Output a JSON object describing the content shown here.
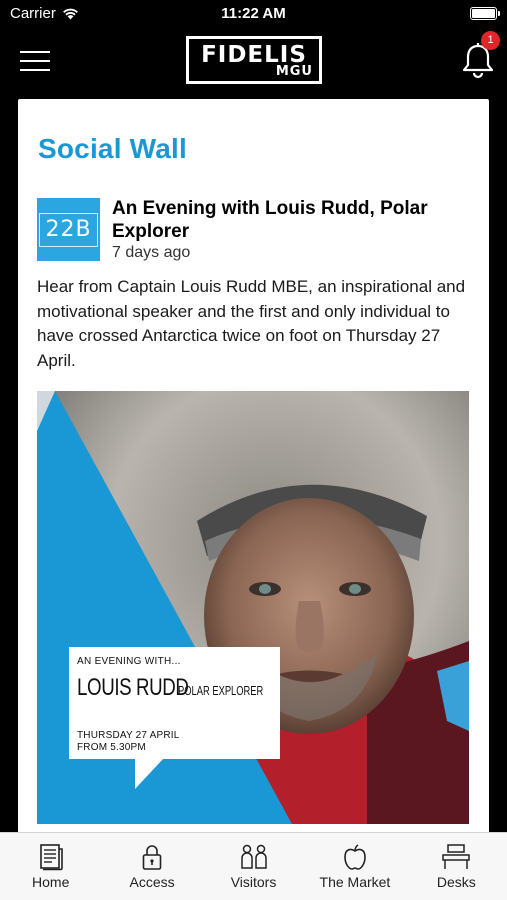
{
  "status_bar": {
    "carrier": "Carrier",
    "time": "11:22 AM"
  },
  "header": {
    "logo_main": "FIDELIS",
    "logo_sub": "MGU",
    "notification_count": "1",
    "icons": {
      "menu": "hamburger-menu-icon",
      "notifications": "bell-icon",
      "signal": "wifi-icon",
      "battery": "battery-icon"
    }
  },
  "page": {
    "title": "Social Wall"
  },
  "post": {
    "avatar_text": "22B",
    "title": "An Evening with Louis Rudd, Polar Explorer",
    "time_ago": "7 days ago",
    "body": "Hear from Captain Louis Rudd MBE, an inspirational and motivational speaker and the first and only individual to have crossed Antarctica twice on foot on Thursday 27 April.",
    "image": {
      "eyebrow": "AN EVENING WITH...",
      "name": "LOUIS RUDD",
      "role": "POLAR EXPLORER",
      "date_line1": "THURSDAY 27 APRIL",
      "date_line2": "FROM 5.30PM",
      "accent_color": "#1a98d5"
    }
  },
  "tabs": [
    {
      "label": "Home",
      "icon": "newspaper-icon"
    },
    {
      "label": "Access",
      "icon": "lock-icon"
    },
    {
      "label": "Visitors",
      "icon": "visitors-icon"
    },
    {
      "label": "The Market",
      "icon": "apple-icon"
    },
    {
      "label": "Desks",
      "icon": "desk-icon"
    }
  ],
  "colors": {
    "brand_blue": "#1a98d5",
    "badge_red": "#e0262b",
    "background": "#000000"
  }
}
